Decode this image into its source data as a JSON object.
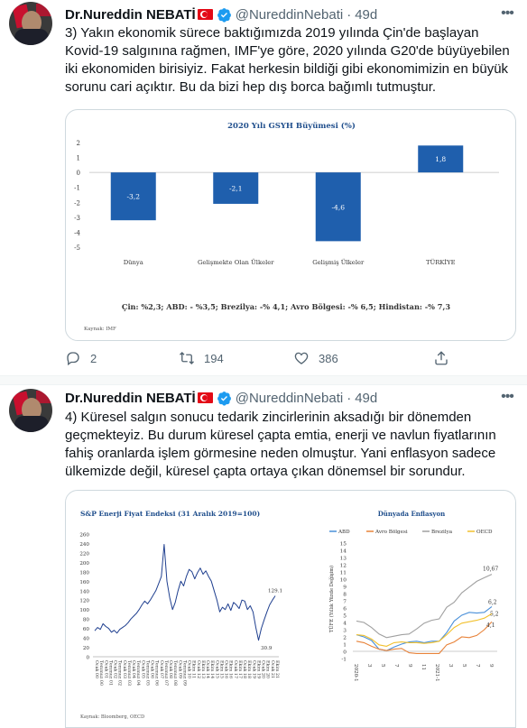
{
  "tweets": [
    {
      "author_name": "Dr.Nureddin NEBATİ",
      "handle": "@NureddinNebati",
      "separator": "·",
      "time": "49d",
      "text": "3) Yakın ekonomik sürece baktığımızda 2019 yılında Çin'de başlayan Kovid-19 salgınına rağmen, IMF'ye  göre, 2020 yılında G20'de büyüyebilen iki ekonomiden birisiyiz. Fakat herkesin bildiği gibi ekonomimizin en büyük sorunu cari açıktır. Bu da bizi hep dış borca bağımlı tutmuştur.",
      "replies": "2",
      "retweets": "194",
      "likes": "386"
    },
    {
      "author_name": "Dr.Nureddin NEBATİ",
      "handle": "@NureddinNebati",
      "separator": "·",
      "time": "49d",
      "text": "4) Küresel salgın sonucu tedarik zincirlerinin aksadığı bir dönemden geçmekteyiz. Bu durum küresel çapta emtia, enerji ve navlun fiyatlarının fahiş oranlarda işlem görmesine neden olmuştur. Yani enflasyon sadece ülkemizde değil, küresel çapta ortaya çıkan dönemsel bir sorundur."
    }
  ],
  "icons": {
    "verified": "verified-badge-icon",
    "flag": "turkish-flag-icon",
    "more": "more-icon",
    "reply": "reply-icon",
    "retweet": "retweet-icon",
    "like": "like-icon",
    "share": "share-icon"
  },
  "colors": {
    "bar": "#1f5fad",
    "link_blue": "#1d9bf0",
    "text_secondary": "#536471"
  },
  "chart_data": [
    {
      "type": "bar",
      "title": "2020 Yılı GSYH Büyümesi (%)",
      "categories": [
        "Dünya",
        "Gelişmekte Olan Ülkeler",
        "Gelişmiş Ülkeler",
        "TÜRKİYE"
      ],
      "values": [
        -3.2,
        -2.1,
        -4.6,
        1.8
      ],
      "value_labels": [
        "-3,2",
        "-2,1",
        "-4,6",
        "1,8"
      ],
      "ylim": [
        -5,
        2
      ],
      "yticks": [
        "2",
        "1",
        "0",
        "-1",
        "-2",
        "-3",
        "-4",
        "-5"
      ],
      "footnote": "Çin: %2,3; ABD: - %3,5; Brezilya: -% 4,1; Avro Bölgesi: -% 6,5; Hindistan: -% 7,3",
      "source": "Kaynak: IMF"
    },
    {
      "type": "line",
      "title": "S&P Enerji Fiyat Endeksi (31 Aralık 2019=100)",
      "ylim": [
        0,
        260
      ],
      "yticks": [
        "260",
        "240",
        "220",
        "200",
        "180",
        "160",
        "140",
        "120",
        "100",
        "80",
        "60",
        "40",
        "20",
        "0"
      ],
      "x_ticks": [
        "Ocak 00",
        "Temmuz 00",
        "Ocak 01",
        "Temmuz 01",
        "Ocak 02",
        "Temmuz 02",
        "Ocak 03",
        "Temmuz 03",
        "Ocak 04",
        "Temmuz 04",
        "Ocak 05",
        "Temmuz 05",
        "Ocak 06",
        "Temmuz 06",
        "Ocak 07",
        "Temmuz 07",
        "Ocak 08",
        "Temmuz 08",
        "Ocak 09",
        "Temmuz 09",
        "Ocak 10",
        "Ekim 11",
        "Ocak 12",
        "Ekim 13",
        "Ocak 14",
        "Ekim 14",
        "Ocak 15",
        "Ekim 15",
        "Ocak 16",
        "Ekim 16",
        "Ocak 17",
        "Ekim 17",
        "Ocak 18",
        "Ekim 18",
        "Ocak 19",
        "Ekim 19",
        "Ocak 20",
        "Ekim 20",
        "Ocak 21",
        "Ekim 21"
      ],
      "series": [
        {
          "values": [
            55,
            62,
            58,
            70,
            64,
            60,
            52,
            56,
            50,
            58,
            62,
            66,
            72,
            80,
            86,
            92,
            100,
            110,
            118,
            112,
            120,
            130,
            140,
            155,
            170,
            238,
            160,
            125,
            100,
            115,
            140,
            160,
            150,
            170,
            185,
            180,
            165,
            178,
            188,
            175,
            182,
            170,
            160,
            140,
            120,
            95,
            105,
            100,
            112,
            98,
            115,
            110,
            102,
            120,
            118,
            100,
            108,
            95,
            62,
            35,
            60,
            78,
            95,
            110,
            120,
            129.1
          ]
        }
      ],
      "annotations": [
        "129.1",
        "30.9"
      ],
      "color": "#1f3f8f",
      "source": "Kaynak: Bloomberg, OECD"
    },
    {
      "type": "line",
      "title": "Dünyada Enflasyon",
      "ylabel": "TÜFE (Yıllık Yüzde Değişim)",
      "ylim": [
        -1,
        15
      ],
      "yticks": [
        "15",
        "14",
        "13",
        "12",
        "11",
        "10",
        "9",
        "8",
        "7",
        "6",
        "5",
        "4",
        "3",
        "2",
        "1",
        "0",
        "-1"
      ],
      "x_ticks": [
        "2020-1",
        "3",
        "5",
        "7",
        "9",
        "11",
        "2021-1",
        "3",
        "5",
        "7",
        "9"
      ],
      "series": [
        {
          "name": "ABD",
          "color": "#4a90d9",
          "values": [
            2.3,
            2.0,
            1.5,
            0.3,
            0.1,
            0.6,
            1.0,
            1.3,
            1.4,
            1.2,
            1.4,
            1.4,
            2.6,
            4.2,
            5.0,
            5.4,
            5.3,
            5.4,
            6.2
          ]
        },
        {
          "name": "Avro Bölgesi",
          "color": "#e8833a",
          "values": [
            1.4,
            1.2,
            0.7,
            0.3,
            0.1,
            0.3,
            0.4,
            -0.2,
            -0.3,
            -0.3,
            -0.3,
            -0.3,
            0.9,
            1.3,
            2.0,
            1.9,
            2.2,
            3.0,
            4.1
          ]
        },
        {
          "name": "Brezilya",
          "color": "#a0a0a0",
          "values": [
            4.2,
            4.0,
            3.3,
            2.4,
            1.9,
            2.1,
            2.3,
            2.4,
            3.1,
            3.9,
            4.3,
            4.5,
            6.1,
            6.8,
            8.1,
            8.9,
            9.7,
            10.2,
            10.67
          ]
        },
        {
          "name": "OECD",
          "color": "#f2c12e",
          "values": [
            2.3,
            2.2,
            1.7,
            0.9,
            0.7,
            1.2,
            1.3,
            1.2,
            1.2,
            1.1,
            1.2,
            1.4,
            2.3,
            3.3,
            3.9,
            4.1,
            4.3,
            4.6,
            5.2
          ]
        }
      ],
      "annotations": [
        "10,67",
        "6,2",
        "5,2",
        "4,1"
      ]
    }
  ]
}
